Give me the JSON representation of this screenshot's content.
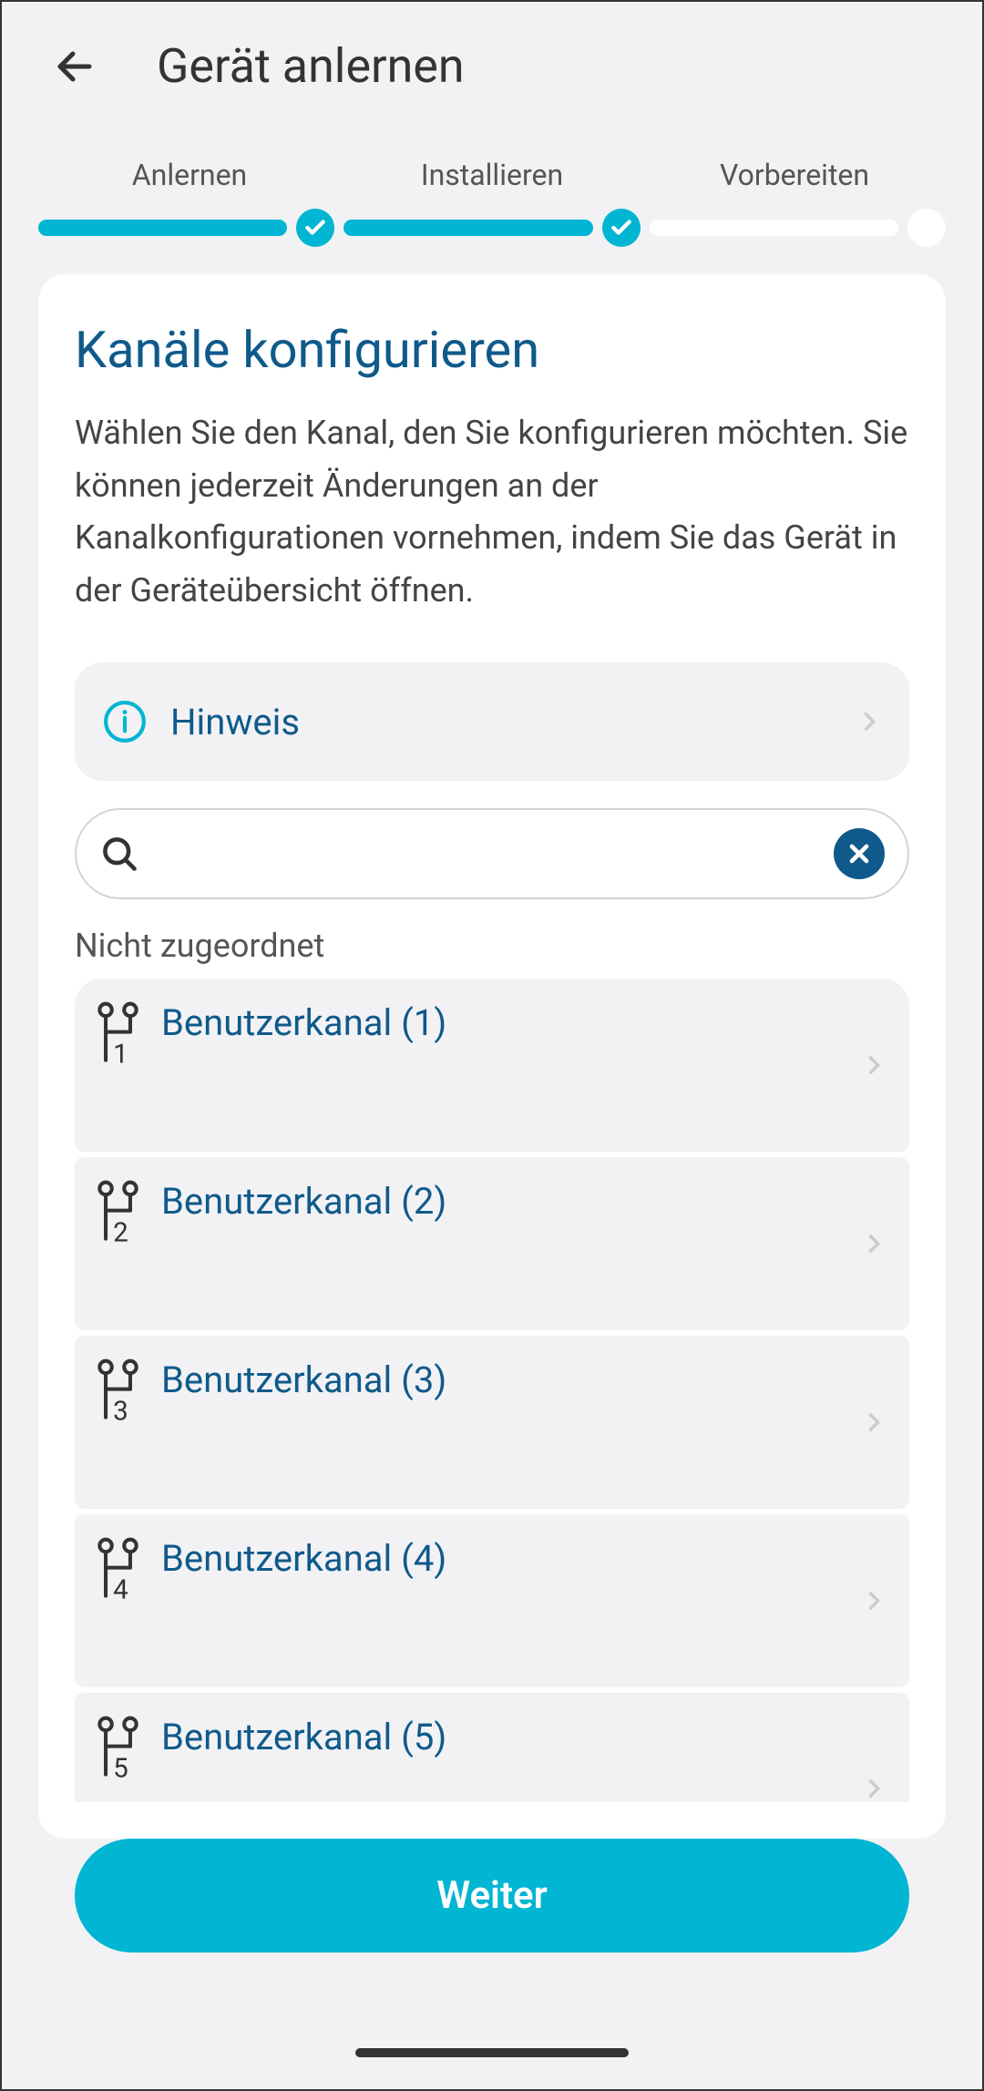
{
  "header": {
    "title": "Gerät anlernen"
  },
  "stepper": {
    "steps": [
      {
        "label": "Anlernen",
        "done": true
      },
      {
        "label": "Installieren",
        "done": true
      },
      {
        "label": "Vorbereiten",
        "done": false
      }
    ]
  },
  "card": {
    "title": "Kanäle konfigurieren",
    "description": "Wählen Sie den Kanal, den Sie konfigurieren möchten. Sie können jederzeit Änderungen an der Kanalkonfigurationen vornehmen, indem Sie das Gerät in der Geräteübersicht öffnen."
  },
  "hint": {
    "label": "Hinweis"
  },
  "search": {
    "value": "",
    "placeholder": ""
  },
  "section": {
    "unassigned_label": "Nicht zugeordnet"
  },
  "channels": [
    {
      "label": "Benutzerkanal (1)",
      "index": "1"
    },
    {
      "label": "Benutzerkanal (2)",
      "index": "2"
    },
    {
      "label": "Benutzerkanal (3)",
      "index": "3"
    },
    {
      "label": "Benutzerkanal (4)",
      "index": "4"
    },
    {
      "label": "Benutzerkanal (5)",
      "index": "5"
    }
  ],
  "actions": {
    "continue": "Weiter"
  }
}
